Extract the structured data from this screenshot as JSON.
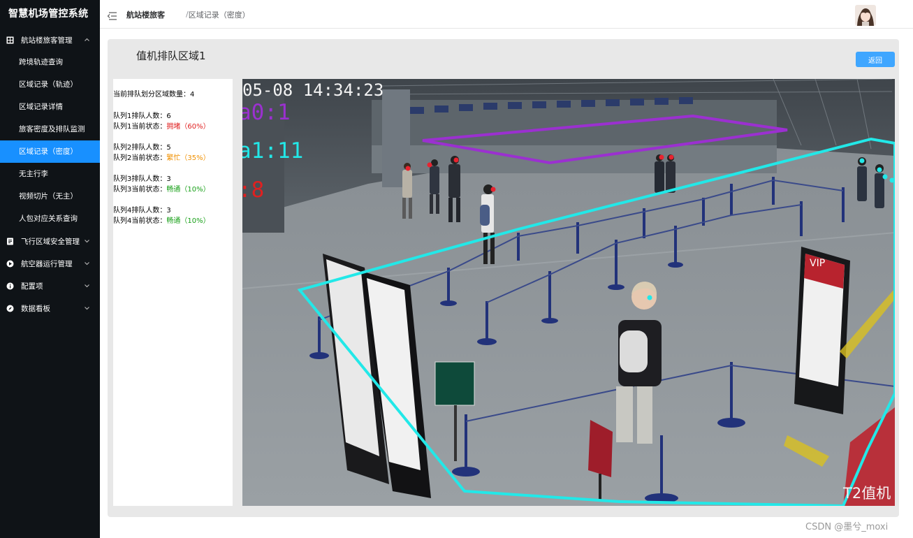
{
  "sidebar": {
    "app_title": "智慧机场管控系统",
    "groups": [
      {
        "label": "航站楼旅客管理",
        "icon": "grid-icon",
        "expanded": true,
        "items": [
          {
            "label": "跨境轨迹查询"
          },
          {
            "label": "区域记录（轨迹）"
          },
          {
            "label": "区域记录详情"
          },
          {
            "label": "旅客密度及排队监测"
          },
          {
            "label": "区域记录（密度）",
            "active": true
          },
          {
            "label": "无主行李"
          },
          {
            "label": "视频切片（无主）"
          },
          {
            "label": "人包对应关系查询"
          }
        ]
      },
      {
        "label": "飞行区域安全管理",
        "icon": "document-icon",
        "expanded": false
      },
      {
        "label": "航空器运行管理",
        "icon": "play-icon",
        "expanded": false
      },
      {
        "label": "配置项",
        "icon": "info-icon",
        "expanded": false
      },
      {
        "label": "数据看板",
        "icon": "compass-icon",
        "expanded": false
      }
    ]
  },
  "header": {
    "breadcrumb": [
      "航站楼旅客",
      "区域记录（密度）"
    ],
    "breadcrumb_separator": "/"
  },
  "main": {
    "title": "值机排队区域1",
    "back_button": "返回",
    "summary": {
      "label": "当前排队划分区域数量：",
      "value": "4"
    },
    "queues": [
      {
        "count_label": "队列1排队人数：",
        "count": "6",
        "status_label": "队列1当前状态：",
        "status": "拥堵（60%）",
        "status_color": "#e02020"
      },
      {
        "count_label": "队列2排队人数：",
        "count": "5",
        "status_label": "队列2当前状态：",
        "status": "繁忙（35%）",
        "status_color": "#f09000"
      },
      {
        "count_label": "队列3排队人数：",
        "count": "3",
        "status_label": "队列3当前状态：",
        "status": "畅通（10%）",
        "status_color": "#18a018"
      },
      {
        "count_label": "队列4排队人数：",
        "count": "3",
        "status_label": "队列4当前状态：",
        "status": "畅通（10%）",
        "status_color": "#18a018"
      }
    ],
    "camera": {
      "timestamp": "05-08 14:34:23",
      "area_labels": [
        "a0:1",
        "a1:11",
        ":8"
      ],
      "area_colors": [
        "#9b30d0",
        "#22e8e8",
        "#e02020"
      ],
      "location_label": "T2值机",
      "vip_sign": "VIP"
    }
  },
  "watermark": "CSDN @墨兮_moxi",
  "colors": {
    "sidebar_bg": "#0f1317",
    "active_item": "#1890ff",
    "button": "#3fa6ff",
    "main_bg": "#e8e8e8"
  }
}
